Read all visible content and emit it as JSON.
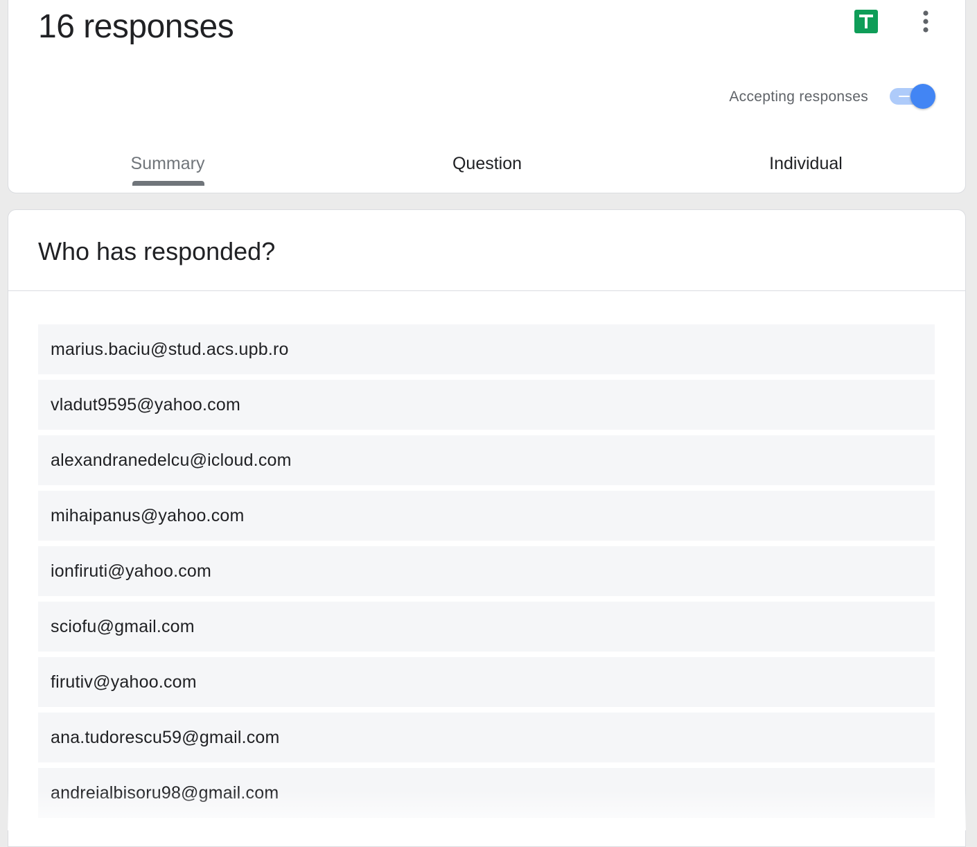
{
  "header": {
    "title": "16 responses",
    "accepting_label": "Accepting responses",
    "accepting_on": true,
    "toggle_color": "#4285f4",
    "sheets_icon_color": "#0f9d58"
  },
  "tabs": [
    {
      "label": "Summary",
      "active": true
    },
    {
      "label": "Question",
      "active": false
    },
    {
      "label": "Individual",
      "active": false
    }
  ],
  "respondents": {
    "title": "Who has responded?",
    "items": [
      "marius.baciu@stud.acs.upb.ro",
      "vladut9595@yahoo.com",
      "alexandranedelcu@icloud.com",
      "mihaipanus@yahoo.com",
      "ionfiruti@yahoo.com",
      "sciofu@gmail.com",
      "firutiv@yahoo.com",
      "ana.tudorescu59@gmail.com",
      "andreialbisoru98@gmail.com"
    ]
  }
}
